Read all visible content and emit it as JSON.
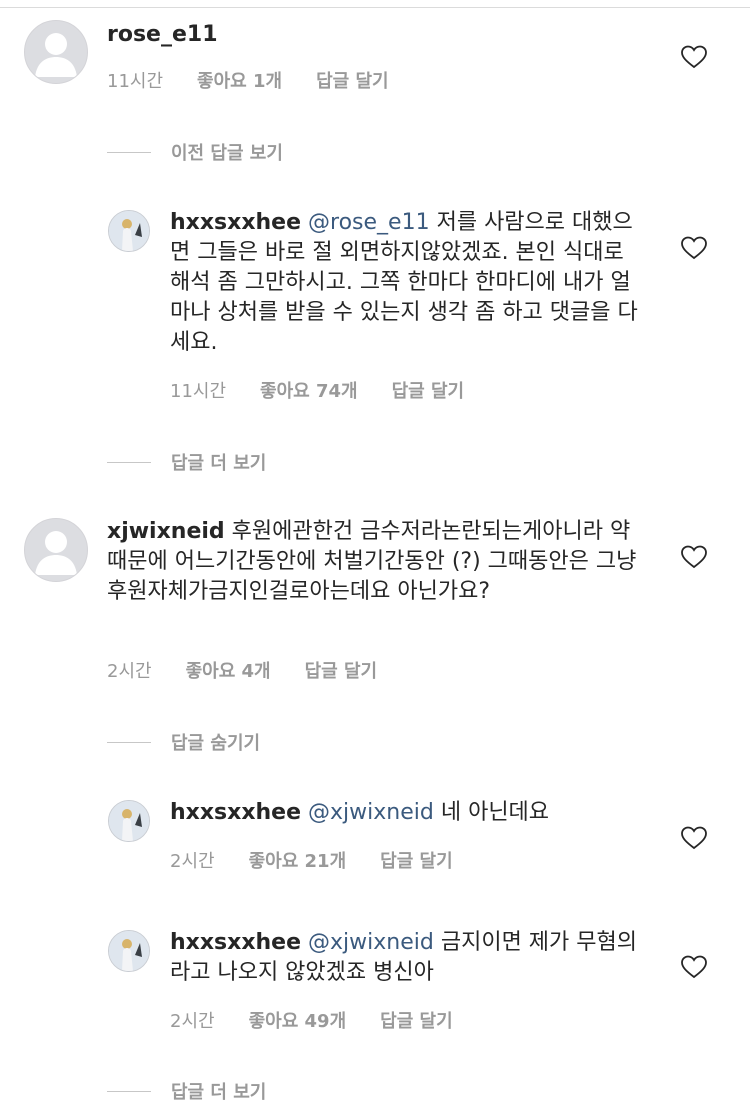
{
  "comments": [
    {
      "username": "rose_e11",
      "text": "",
      "time": "11시간",
      "likes": "좋아요 1개",
      "reply": "답글 달기"
    },
    {
      "username": "xjwixneid",
      "text": "후원에관한건 금수저라논란되는게아니라 약때문에 어느기간동안에 처벌기간동안 (?) 그때동안은 그냥 후원자체가금지인걸로아는데요 아닌가요?",
      "time": "2시간",
      "likes": "좋아요 4개",
      "reply": "답글 달기"
    }
  ],
  "replies": [
    {
      "username": "hxxsxxhee",
      "mention": "@rose_e11",
      "text": "저를 사람으로 대했으면 그들은 바로 절 외면하지않았겠죠. 본인 식대로 해석 좀 그만하시고. 그쪽 한마다 한마디에 내가 얼마나 상처를 받을 수 있는지 생각 좀 하고 댓글을 다세요.",
      "time": "11시간",
      "likes": "좋아요 74개",
      "reply": "답글 달기"
    },
    {
      "username": "hxxsxxhee",
      "mention": "@xjwixneid",
      "text": "네 아닌데요",
      "time": "2시간",
      "likes": "좋아요 21개",
      "reply": "답글 달기"
    },
    {
      "username": "hxxsxxhee",
      "mention": "@xjwixneid",
      "text": "금지이면 제가 무혐의라고 나오지 않았겠죠 병신아",
      "time": "2시간",
      "likes": "좋아요 49개",
      "reply": "답글 달기"
    }
  ],
  "toggles": {
    "prev_replies": "이전 답글 보기",
    "more_replies": "답글 더 보기",
    "hide_replies": "답글 숨기기",
    "more_replies_bottom": "답글 더 보기"
  },
  "colors": {
    "mention": "#3b5a7e",
    "meta": "#999999",
    "text": "#262626"
  },
  "icons": {
    "heart": "heart-icon",
    "default_avatar": "default-avatar-icon"
  }
}
